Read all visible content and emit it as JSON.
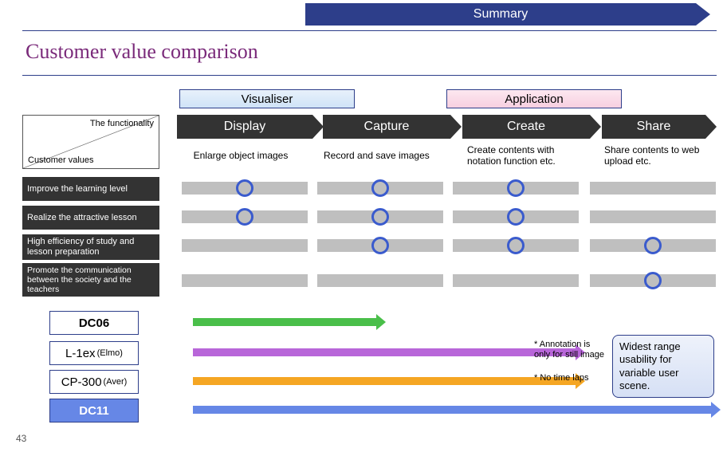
{
  "banner": "Summary",
  "title": "Customer value comparison",
  "categories": {
    "vis": "Visualiser",
    "app": "Application"
  },
  "func": {
    "f1": "Display",
    "f2": "Capture",
    "f3": "Create",
    "f4": "Share"
  },
  "corner": {
    "tf": "The functionality",
    "cv": "Customer values"
  },
  "desc": {
    "d1": "Enlarge object images",
    "d2": "Record and save images",
    "d3": "Create contents with notation function etc.",
    "d4": "Share contents to web upload etc."
  },
  "rows": {
    "r1": "Improve the learning level",
    "r2": "Realize the attractive lesson",
    "r3": "High efficiency of study and lesson preparation",
    "r4": "Promote the communication between the society and the teachers"
  },
  "checks": {
    "r1": [
      true,
      true,
      true,
      false
    ],
    "r2": [
      true,
      true,
      true,
      false
    ],
    "r3": [
      false,
      true,
      true,
      true
    ],
    "r4": [
      false,
      false,
      false,
      true
    ]
  },
  "products": {
    "p1": "DC06",
    "p2_main": "L-1ex",
    "p2_sub": "(Elmo)",
    "p3_main": "CP-300",
    "p3_sub": "(Aver)",
    "p4": "DC11"
  },
  "notes": {
    "n1": "* Annotation is only for still image",
    "n2": "* No time laps"
  },
  "callout": "Widest range usability for variable user scene.",
  "page": "43"
}
